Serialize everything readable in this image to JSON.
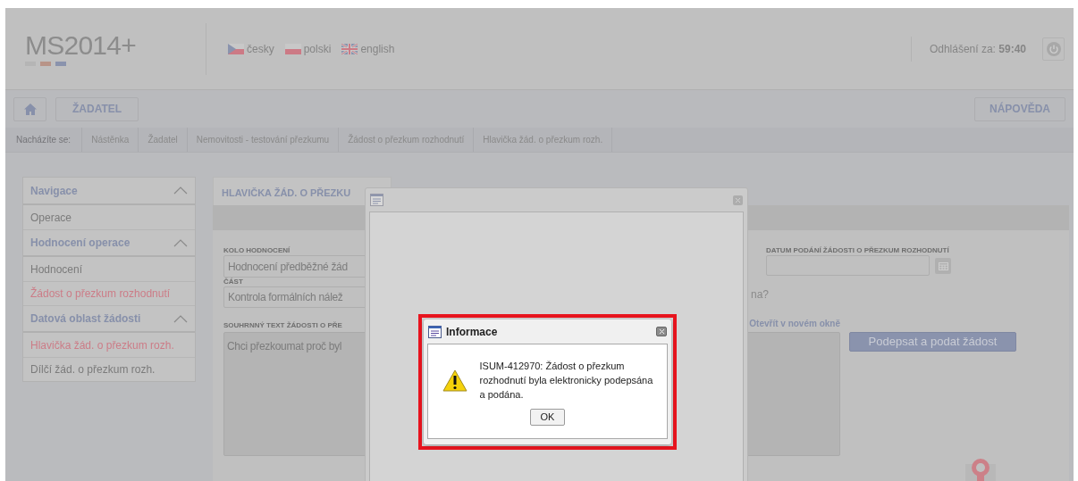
{
  "header": {
    "logo": "**MS**2014**+**",
    "languages": [
      {
        "label": "česky",
        "kind": "cz"
      },
      {
        "label": "polski",
        "kind": "pl"
      },
      {
        "label": "english",
        "kind": "gb"
      }
    ],
    "logout_text": "Odhlášení za: **59:40**"
  },
  "toolbar": {
    "role_button": "ŽADATEL",
    "help_button": "NÁPOVĚDA"
  },
  "breadcrumb": {
    "label": "Nacházíte se:",
    "items": [
      "Nástěnka",
      "Žadatel",
      "Nemovitosti - testování přezkumu",
      "Žádost o přezkum rozhodnutí",
      "Hlavička žád. o přezkum rozh."
    ]
  },
  "sidebar": {
    "groups": [
      {
        "title": "Navigace",
        "expanded": true,
        "items": [
          {
            "label": "Operace",
            "selected": false
          }
        ]
      },
      {
        "title": "Hodnocení operace",
        "expanded": true,
        "items": [
          {
            "label": "Hodnocení",
            "selected": false
          },
          {
            "label": "Žádost o přezkum rozhodnutí",
            "selected": true
          }
        ]
      },
      {
        "title": "Datová oblast žádosti",
        "expanded": true,
        "items": [
          {
            "label": "Hlavička žád. o přezkum rozh.",
            "selected": true
          },
          {
            "label": "Dílčí žád. o přezkum rozh.",
            "selected": false
          }
        ]
      }
    ]
  },
  "form": {
    "title": "HLAVIČKA ŽÁD. O PŘEZKU",
    "round_label": "KOLO HODNOCENÍ",
    "round_value": "Hodnocení předběžné žád",
    "part_label": "ČÁST",
    "part_value": "Kontrola formálních nálež",
    "summary_label": "SOUHRNNÝ TEXT ŽÁDOSTI O PŘE",
    "summary_value": "Chci přezkoumat proč byl",
    "date_label": "DATUM PODÁNÍ ŽÁDOSTI O PŘEZKUM ROZHODNUTÍ",
    "question_fragment": "na?",
    "open_link": "Otevřít v novém okně",
    "sign_button": "Podepsat a podat žádost"
  },
  "dialog": {
    "title": "Informace",
    "message": "ISUM-412970: Žádost o přezkum rozhodnutí byla elektronicky podepsána a podána.",
    "ok_button": "OK"
  }
}
